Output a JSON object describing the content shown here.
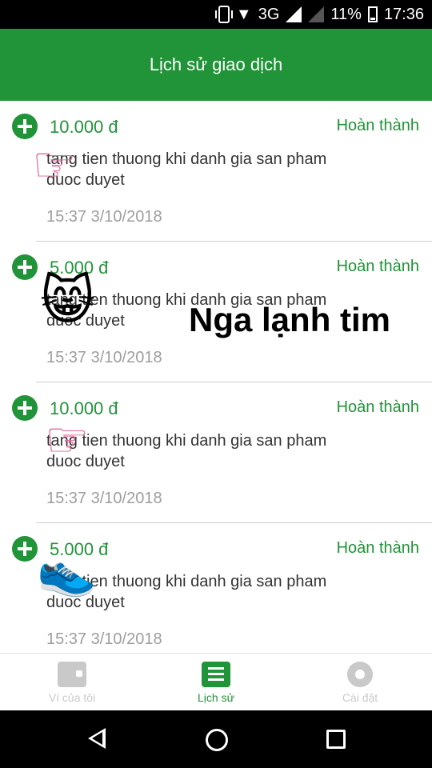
{
  "status_bar": {
    "network": "3G",
    "battery": "11%",
    "time": "17:36"
  },
  "app_bar": {
    "title": "Lịch sử giao dịch"
  },
  "transactions": [
    {
      "amount": "10.000 đ",
      "status": "Hoàn thành",
      "description": "tang tien thuong khi danh gia san pham duoc duyet",
      "time": "15:37 3/10/2018",
      "sticker": "pointing-hand"
    },
    {
      "amount": "5.000 đ",
      "status": "Hoàn thành",
      "description": "tang tien thuong khi danh gia san pham duoc duyet",
      "time": "15:37 3/10/2018",
      "sticker": "grinning-cat"
    },
    {
      "amount": "10.000 đ",
      "status": "Hoàn thành",
      "description": "tang tien thuong khi danh gia san pham duoc duyet",
      "time": "15:37 3/10/2018",
      "sticker": "pointing-hand"
    },
    {
      "amount": "5.000 đ",
      "status": "Hoàn thành",
      "description": "tang tien thuong khi danh gia san pham duoc duyet",
      "time": "15:37 3/10/2018",
      "sticker": "sneaker"
    }
  ],
  "overlay": {
    "caption": "Nga lạnh tim"
  },
  "bottom_nav": {
    "items": [
      {
        "label": "Ví của tôi",
        "icon": "wallet-icon",
        "active": false
      },
      {
        "label": "Lịch sử",
        "icon": "list-icon",
        "active": true
      },
      {
        "label": "Cài đặt",
        "icon": "gear-icon",
        "active": false
      }
    ]
  },
  "colors": {
    "primary": "#219338",
    "inactive": "#c9c9c9",
    "muted_text": "#9e9e9e"
  }
}
